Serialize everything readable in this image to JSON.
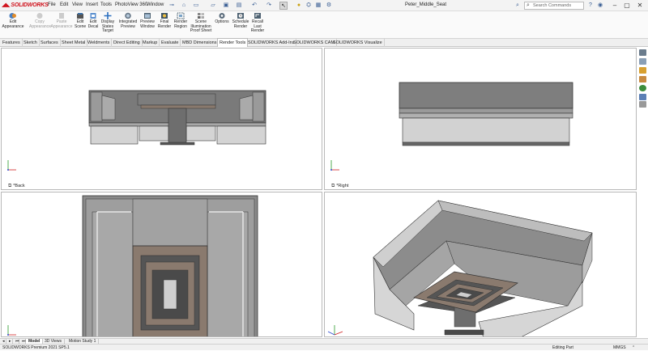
{
  "app": {
    "logo_text": "SOLIDWORKS",
    "document_title": "Peter_Middle_Seat",
    "search_placeholder": "Search Commands"
  },
  "menu": [
    "File",
    "Edit",
    "View",
    "Insert",
    "Tools",
    "PhotoView 360",
    "Window"
  ],
  "ribbon": {
    "buttons": [
      {
        "label": "Edit\nAppearance",
        "icon": "edit-appearance-icon",
        "enabled": true
      },
      {
        "label": "Copy\nAppearance",
        "icon": "copy-appearance-icon",
        "enabled": false
      },
      {
        "label": "Paste\nAppearance",
        "icon": "paste-appearance-icon",
        "enabled": false
      },
      {
        "label": "Edit\nScene",
        "icon": "edit-scene-icon",
        "enabled": true
      },
      {
        "label": "Edit\nDecal",
        "icon": "edit-decal-icon",
        "enabled": true
      },
      {
        "label": "Display\nStates\nTarget",
        "icon": "display-states-icon",
        "enabled": true
      },
      {
        "label": "Integrated\nPreview",
        "icon": "integrated-preview-icon",
        "enabled": true
      },
      {
        "label": "Preview\nWindow",
        "icon": "preview-window-icon",
        "enabled": true
      },
      {
        "label": "Final\nRender",
        "icon": "final-render-icon",
        "enabled": true
      },
      {
        "label": "Render\nRegion",
        "icon": "render-region-icon",
        "enabled": true
      },
      {
        "label": "Scene\nIllumination\nProof Sheet",
        "icon": "scene-illumination-icon",
        "enabled": true
      },
      {
        "label": "Options",
        "icon": "options-icon",
        "enabled": true
      },
      {
        "label": "Schedule\nRender",
        "icon": "schedule-render-icon",
        "enabled": true
      },
      {
        "label": "Recall\nLast\nRender",
        "icon": "recall-render-icon",
        "enabled": true
      }
    ]
  },
  "command_tabs": [
    {
      "label": "Features",
      "active": false
    },
    {
      "label": "Sketch",
      "active": false
    },
    {
      "label": "Surfaces",
      "active": false
    },
    {
      "label": "Sheet Metal",
      "active": false
    },
    {
      "label": "Weldments",
      "active": false
    },
    {
      "label": "Direct Editing",
      "active": false
    },
    {
      "label": "Markup",
      "active": false
    },
    {
      "label": "Evaluate",
      "active": false
    },
    {
      "label": "MBD Dimensions",
      "active": false
    },
    {
      "label": "Render Tools",
      "active": true
    },
    {
      "label": "SOLIDWORKS Add-Ins",
      "active": false
    },
    {
      "label": "SOLIDWORKS CAM",
      "active": false
    },
    {
      "label": "SOLIDWORKS Visualize",
      "active": false
    }
  ],
  "viewports": {
    "top_left": {
      "label": "*Back"
    },
    "top_right": {
      "label": "*Right"
    }
  },
  "bottom_tabs": [
    {
      "label": "Model",
      "active": true
    },
    {
      "label": "3D Views",
      "active": false
    },
    {
      "label": "Motion Study 1",
      "active": false
    }
  ],
  "status": {
    "product": "SOLIDWORKS Premium 2021 SP5.1",
    "mode": "Editing Part",
    "units": "MMGS"
  },
  "colors": {
    "brand_red": "#d0111b",
    "model_dark": "#777777",
    "model_mid": "#9a9a9a",
    "model_light": "#c8c8c8",
    "table_brown": "#8a7a6e",
    "viewport_border": "#b8b8b8"
  }
}
